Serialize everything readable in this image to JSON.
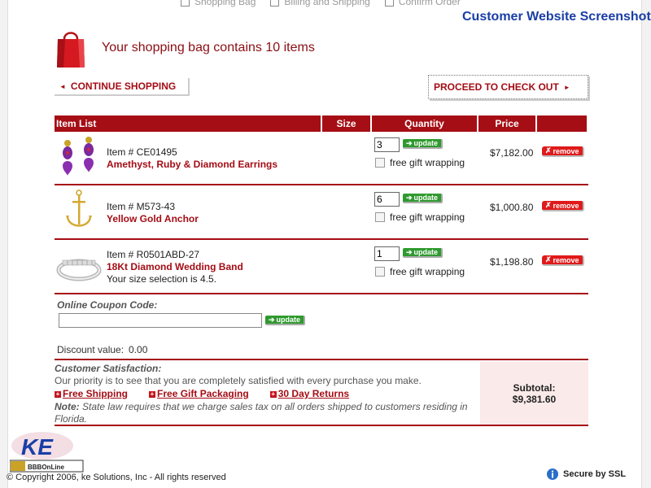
{
  "watermark": "Customer Website  Screenshot",
  "steps": [
    "Shopping Bag",
    "Billing and Shipping",
    "Confirm Order"
  ],
  "bag_title": "Your shopping bag contains 10 items",
  "nav": {
    "continue": "CONTINUE SHOPPING",
    "checkout": "PROCEED TO CHECK OUT"
  },
  "table_headers": {
    "item": "Item List",
    "size": "Size",
    "quantity": "Quantity",
    "price": "Price"
  },
  "items": [
    {
      "item_no": "Item # CE01495",
      "name": "Amethyst, Ruby & Diamond Earrings",
      "note": "",
      "qty": "3",
      "price": "$7,182.00",
      "gift_label": "free gift wrapping"
    },
    {
      "item_no": "Item # M573-43",
      "name": "Yellow Gold Anchor",
      "note": "",
      "qty": "6",
      "price": "$1,000.80",
      "gift_label": "free gift wrapping"
    },
    {
      "item_no": "Item # R0501ABD-27",
      "name": "18Kt Diamond Wedding Band",
      "note": "Your size selection is 4.5.",
      "qty": "1",
      "price": "$1,198.80",
      "gift_label": "free gift wrapping"
    }
  ],
  "buttons": {
    "update": "update",
    "remove": "remove"
  },
  "coupon": {
    "label": "Online Coupon Code:",
    "value": "",
    "discount_label": "Discount value:",
    "discount_value": "0.00"
  },
  "satisfaction": {
    "heading": "Customer Satisfaction:",
    "text": "Our priority is to see that you are completely satisfied with every purchase you make.",
    "links": [
      "Free Shipping",
      "Free Gift Packaging",
      "30 Day Returns"
    ],
    "note_label": "Note:",
    "note_text": "State law requires that we charge sales tax on all orders shipped to customers residing in Florida."
  },
  "subtotal": {
    "label": "Subtotal:",
    "value": "$9,381.60"
  },
  "footer": {
    "logo_text": "KE",
    "logo_badge": "BBBOnLine",
    "copyright": "© Copyright 2006, ke Solutions, Inc - All rights reserved",
    "ssl": "Secure by SSL"
  },
  "colors": {
    "brand_red": "#a60e15",
    "update_green": "#2e9a2e",
    "remove_red": "#e01a1a",
    "subtotal_bg": "#fbeaea",
    "watermark_blue": "#1a3ea6"
  }
}
